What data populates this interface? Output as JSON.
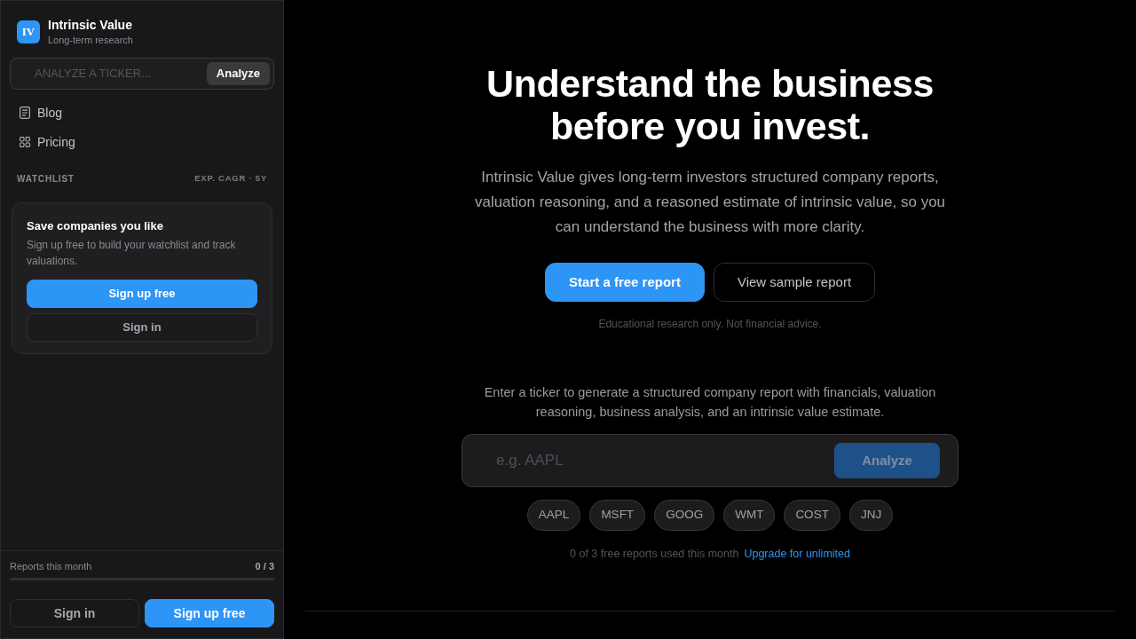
{
  "sidebar": {
    "brand": {
      "logo": "IV",
      "title": "Intrinsic Value",
      "subtitle": "Long-term research"
    },
    "ticker_search": {
      "placeholder": "ANALYZE A TICKER...",
      "button": "Analyze"
    },
    "nav": [
      {
        "kind": "document",
        "label": "Blog"
      },
      {
        "kind": "grid",
        "label": "Pricing"
      }
    ],
    "watchlist": {
      "heading": "WATCHLIST",
      "column_label": "EXP. CAGR · 5Y",
      "card": {
        "title": "Save companies you like",
        "text": "Sign up free to build your watchlist and track valuations.",
        "buttons": [
          {
            "kind": "primary",
            "label": "Sign up free"
          },
          {
            "kind": "secondary",
            "label": "Sign in"
          }
        ]
      }
    },
    "usage": {
      "label": "Reports this month",
      "count": "0 / 3",
      "level": 0
    },
    "buttons": [
      {
        "kind": "secondary",
        "label": "Sign in"
      },
      {
        "kind": "primary",
        "label": "Sign up free"
      }
    ]
  },
  "hero": {
    "title": "Understand the business before you invest.",
    "description": "Intrinsic Value gives long-term investors structured company reports, valuation reasoning, and a reasoned estimate of intrinsic value, so you can understand the business with more clarity.",
    "buttons": [
      {
        "kind": "primary",
        "label": "Start a free report"
      },
      {
        "kind": "secondary",
        "label": "View sample report"
      }
    ],
    "disclaimer": "Educational research only. Not financial advice."
  },
  "analyzer": {
    "intro": "Enter a ticker to generate a structured company report with financials, valuation reasoning, business analysis, and an intrinsic value estimate.",
    "input": {
      "placeholder": "e.g. AAPL"
    },
    "button": {
      "label": "Analyze",
      "disabled": true
    },
    "tickers": [
      "AAPL",
      "MSFT",
      "GOOG",
      "WMT",
      "COST",
      "JNJ"
    ],
    "usage_note": "0 of 3 free reports used this month",
    "upgrade_link": "Upgrade for unlimited"
  }
}
